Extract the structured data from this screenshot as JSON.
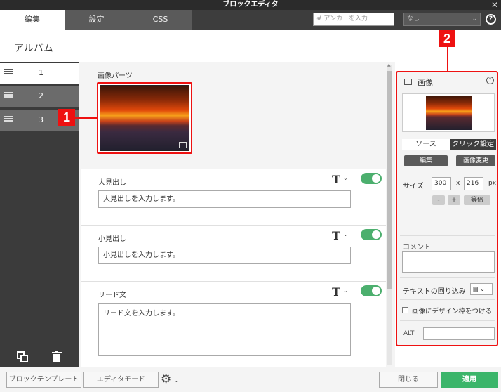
{
  "window": {
    "title": "ブロックエディタ",
    "close": "✕"
  },
  "tabs": [
    {
      "label": "編集"
    },
    {
      "label": "設定"
    },
    {
      "label": "CSS"
    }
  ],
  "toolbar": {
    "anchor_placeholder": "# アンカーを入力",
    "class_select": "なし",
    "help": "?"
  },
  "page_title": "アルバム",
  "list": [
    {
      "num": "1"
    },
    {
      "num": "2"
    },
    {
      "num": "3"
    }
  ],
  "blocks": {
    "image": {
      "label": "画像パーツ"
    },
    "heading_large": {
      "label": "大見出し",
      "placeholder": "大見出しを入力します。"
    },
    "heading_small": {
      "label": "小見出し",
      "placeholder": "小見出しを入力します。"
    },
    "lead": {
      "label": "リード文",
      "placeholder": "リード文を入力します。"
    },
    "text_icon": "T",
    "chevron": "⌄"
  },
  "callouts": {
    "one": "1",
    "two": "2"
  },
  "right_panel": {
    "title": "画像",
    "help": "?",
    "tabs": {
      "source": "ソース",
      "click": "クリック設定"
    },
    "edit_button": "編集",
    "change_button": "画像変更",
    "size_label": "サイズ",
    "width": "300",
    "x": "x",
    "height": "216",
    "unit": "px",
    "minus": "-",
    "plus": "+",
    "fit": "等倍",
    "comment_label": "コメント",
    "wrap_label": "テキストの回り込み",
    "frame_label": "画像にデザイン枠をつける",
    "alt_label": "ALT"
  },
  "footer": {
    "block_template": "ブロックテンプレート",
    "editor_mode": "エディタモード",
    "gear": "⚙",
    "chevron": "⌄",
    "close": "閉じる",
    "apply": "適用"
  }
}
